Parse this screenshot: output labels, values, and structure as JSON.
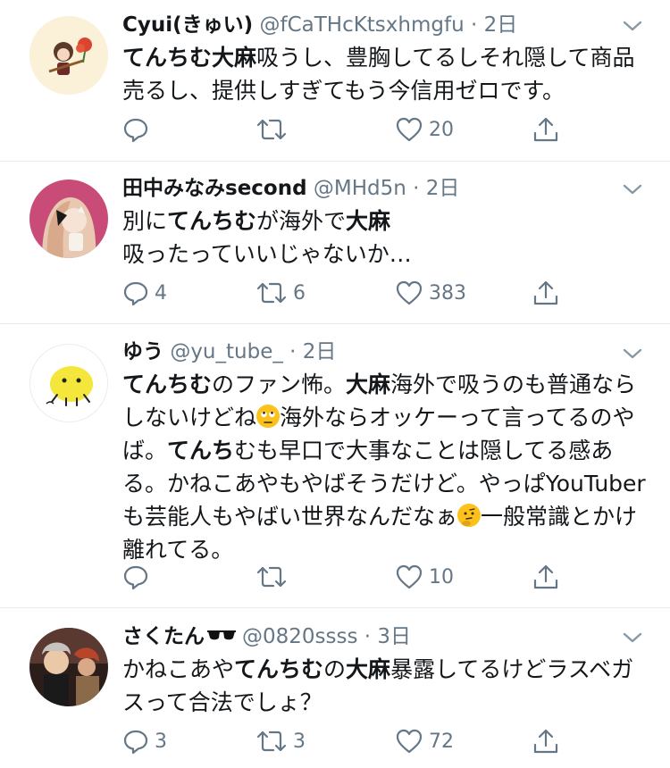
{
  "tweets": [
    {
      "name": "Cyui(きゅい)",
      "handle": "@fCaTHcKtsxhmgfu",
      "dot": "·",
      "time": "2日",
      "seg": [
        "てんちむ大麻",
        "吸うし、豊胸してるしそれ隠して商品",
        "売るし、提供しすぎてもう今信用ゼロです。"
      ],
      "counts": {
        "reply": "",
        "retweet": "",
        "like": "20"
      }
    },
    {
      "name": "田中みなみsecond",
      "handle": "@MHd5n",
      "dot": "·",
      "time": "2日",
      "seg": [
        "別に",
        "てんちむ",
        "が海外で",
        "大麻",
        "吸ったっていいじゃないか…"
      ],
      "counts": {
        "reply": "4",
        "retweet": "6",
        "like": "383"
      }
    },
    {
      "name": "ゆう",
      "handle": "@yu_tube_",
      "dot": "·",
      "time": "2日",
      "seg": [
        "てんちむ",
        "のファン怖。",
        "大麻",
        "海外で吸うのも普通なら",
        "しないけどね",
        "海外ならオッケーって言ってるのや",
        "ば。",
        "てんち",
        "むも早口で大事なことは隠してる感あ",
        "る。かねこあやもやばそうだけど。やっぱYouTuber",
        "も芸能人もやばい世界なんだなぁ",
        "一般常識とかけ",
        "離れてる。"
      ],
      "counts": {
        "reply": "",
        "retweet": "",
        "like": "10"
      }
    },
    {
      "name": "さくたん",
      "handle": "@0820ssss",
      "dot": "·",
      "time": "3日",
      "seg": [
        "かねこあや",
        "てんちむ",
        "の",
        "大麻",
        "暴露してるけどラスベガ",
        "スって合法でしょ？"
      ],
      "counts": {
        "reply": "3",
        "retweet": "3",
        "like": "72"
      }
    }
  ],
  "icons": {
    "reply": "reply-icon",
    "retweet": "retweet-icon",
    "like": "like-icon",
    "share": "share-icon",
    "menu": "chevron-down-icon",
    "emoji_eyeroll": "eye-roll-emoji-icon",
    "emoji_thinking": "thinking-emoji-icon",
    "sunglasses": "sunglasses-icon"
  },
  "colors": {
    "text": "#14171a",
    "secondary": "#657786",
    "divider": "#e6ecf0"
  }
}
